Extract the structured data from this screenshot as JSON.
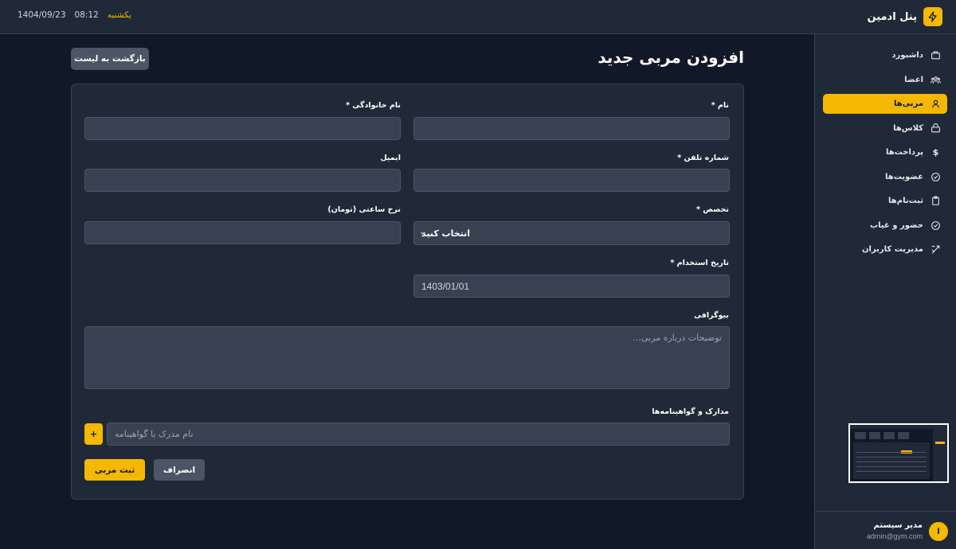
{
  "header": {
    "brand_title": "پنل ادمین",
    "brand_icon": "lightning-icon",
    "date": "1404/09/23",
    "time": "08:12",
    "day": "یکشنبه"
  },
  "sidebar": {
    "items": [
      {
        "label": "داشبورد",
        "icon": "dashboard-icon",
        "active": false
      },
      {
        "label": "اعضا",
        "icon": "users-icon",
        "active": false
      },
      {
        "label": "مربی‌ها",
        "icon": "user-icon",
        "active": true
      },
      {
        "label": "کلاس‌ها",
        "icon": "class-icon",
        "active": false
      },
      {
        "label": "پرداخت‌ها",
        "icon": "dollar-icon",
        "active": false
      },
      {
        "label": "عضویت‌ها",
        "icon": "check-circle-icon",
        "active": false
      },
      {
        "label": "ثبت‌نام‌ها",
        "icon": "clipboard-icon",
        "active": false
      },
      {
        "label": "حضور و غیاب",
        "icon": "check-circle-icon",
        "active": false
      },
      {
        "label": "مدیریت کاربران",
        "icon": "user-settings-icon",
        "active": false
      }
    ],
    "user": {
      "avatar_letter": "ا",
      "name": "مدیر سیستم",
      "email": "admin@gym.com"
    }
  },
  "main": {
    "title": "افزودن مربی جدید",
    "back_button": "بازگشت به لیست",
    "form": {
      "first_name_label": "نام *",
      "first_name_value": "",
      "last_name_label": "نام خانوادگی *",
      "last_name_value": "",
      "phone_label": "شماره تلفن *",
      "phone_value": "",
      "email_label": "ایمیل",
      "email_value": "",
      "specialty_label": "تخصص *",
      "specialty_selected": "انتخاب کنید",
      "hourly_rate_label": "نرخ ساعتی (تومان)",
      "hourly_rate_value": "",
      "hire_date_label": "تاریخ استخدام *",
      "hire_date_value": "1403/01/01",
      "bio_label": "بیوگرافی",
      "bio_placeholder": "توضیحات درباره مربی...",
      "certificates_label": "مدارک و گواهینامه‌ها",
      "certificate_placeholder": "نام مدرک یا گواهینامه",
      "add_certificate_button": "+",
      "cancel_button": "انصراف",
      "submit_button": "ثبت مربی"
    }
  },
  "colors": {
    "accent": "#f5b800",
    "background": "#111827",
    "surface": "#1f2937",
    "input": "#374151"
  }
}
